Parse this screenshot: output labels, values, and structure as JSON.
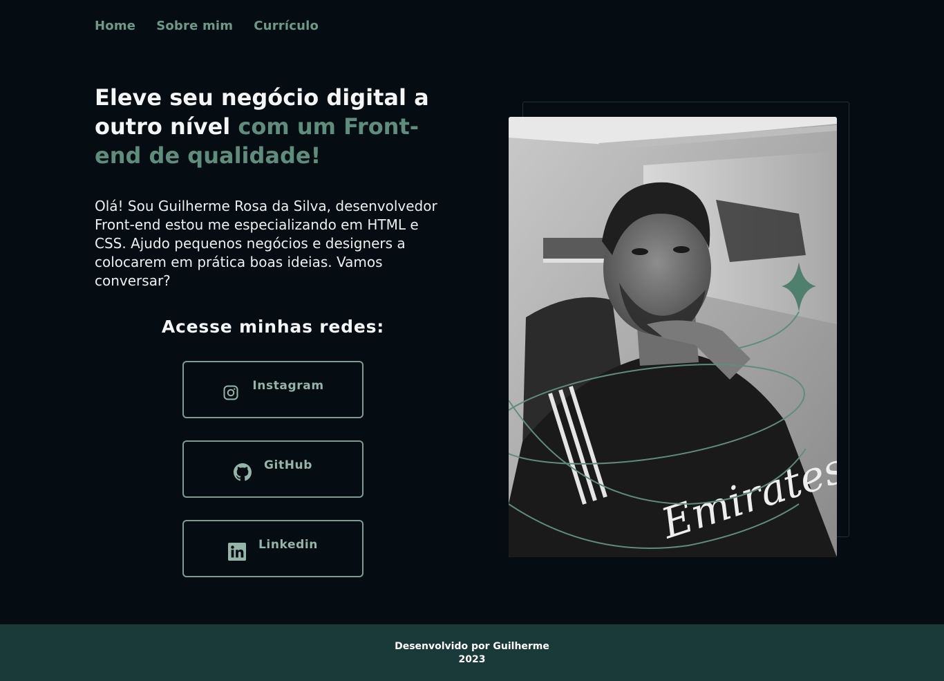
{
  "nav": {
    "items": [
      {
        "label": "Home"
      },
      {
        "label": "Sobre mim"
      },
      {
        "label": "Currículo"
      }
    ]
  },
  "hero": {
    "title_part1": "Eleve seu negócio digital a outro nível ",
    "title_accent": "com um Front-end de qualidade!",
    "intro": "Olá! Sou Guilherme Rosa da Silva, desenvolvedor Front-end estou me especializando em HTML e CSS. Ajudo pequenos negócios e designers a colocarem em prática boas ideias. Vamos conversar?"
  },
  "social": {
    "title": "Acesse minhas redes:",
    "links": [
      {
        "label": "Instagram",
        "icon": "instagram-icon"
      },
      {
        "label": "GitHub",
        "icon": "github-icon"
      },
      {
        "label": "Linkedin",
        "icon": "linkedin-icon"
      }
    ]
  },
  "footer": {
    "line1": "Desenvolvido por Guilherme",
    "line2": "2023"
  },
  "colors": {
    "background": "#050d12",
    "accent": "#5f8d7b",
    "footer_bg": "#1a3a3a",
    "button_border": "#7f9c91"
  }
}
